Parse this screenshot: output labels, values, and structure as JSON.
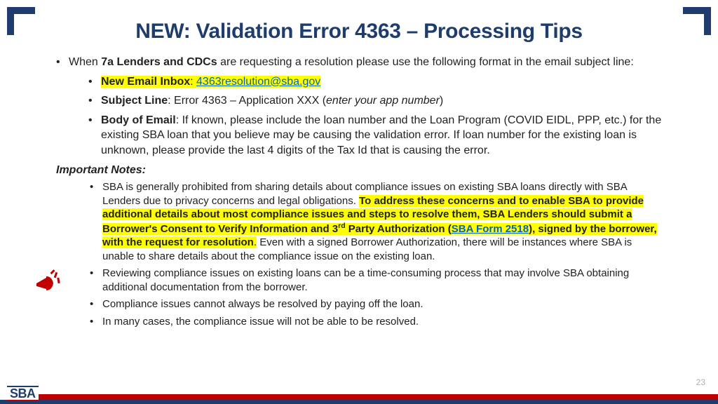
{
  "title": "NEW: Validation Error 4363 – Processing Tips",
  "intro": {
    "pre": "When ",
    "bold": "7a Lenders and CDCs",
    "post": " are requesting a resolution please use the following format in the email subject line:"
  },
  "email_items": {
    "inbox": {
      "label": "New Email Inbox",
      "sep": ": ",
      "link": "4363resolution@sba.gov"
    },
    "subject": {
      "label": "Subject Line",
      "sep": ": Error 4363 – Application XXX (",
      "italic": "enter your app number",
      "close": ")"
    },
    "body": {
      "label": "Body of Email",
      "text": ":  If known, please include the loan number and the Loan Program (COVID EIDL, PPP, etc.) for the existing SBA loan that you believe may be causing the validation error. If loan number for the existing loan is unknown, please provide the last 4 digits of the Tax Id that is causing the error."
    }
  },
  "notes_header": "Important Notes",
  "notes_header_colon": ":",
  "note1": {
    "pre": "SBA is generally prohibited from sharing details about compliance issues on existing SBA loans directly with SBA Lenders due to privacy concerns and legal obligations. ",
    "hl1": "To address these concerns and to enable SBA to provide additional details about most compliance issues and steps to resolve them, SBA Lenders should submit a Borrower's Consent to Verify Information and 3",
    "hl_sup": "rd",
    "hl2": " Party Authorization (",
    "link": "SBA Form 2518",
    "hl3": "), signed by the borrower, with the request for resolution",
    "hl_period": ".",
    "post": "  Even with a signed Borrower Authorization, there will be instances where SBA is unable to share details about the compliance issue on the existing loan."
  },
  "note2": "Reviewing compliance issues on existing loans can be a time-consuming process that may involve SBA obtaining additional documentation from the borrower.",
  "note3": "Compliance issues cannot always be resolved by paying off the loan.",
  "note4": "In many cases, the compliance issue will not be able to be resolved.",
  "page_number": "23",
  "logo": "SBA"
}
